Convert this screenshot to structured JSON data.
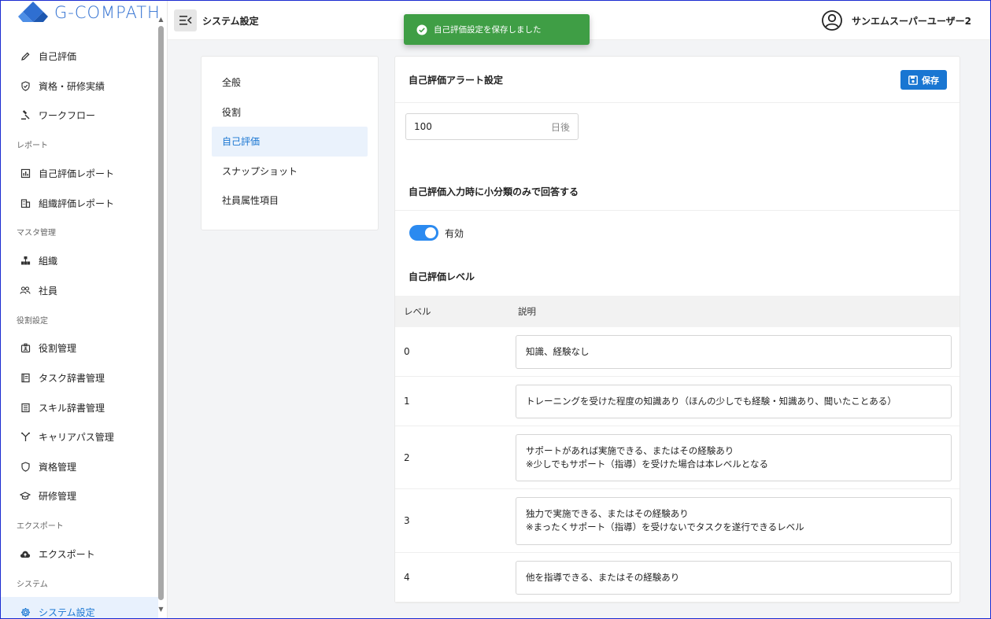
{
  "app": {
    "logo_text": "G-COMPATH",
    "brand_colors": {
      "primary": "#1976d2",
      "logo": "#2f6fd1",
      "toast": "#3f9e45"
    }
  },
  "sidebar": {
    "items": [
      {
        "type": "item",
        "label": "自己評価",
        "icon": "pencil-icon"
      },
      {
        "type": "item",
        "label": "資格・研修実績",
        "icon": "shield-check-icon"
      },
      {
        "type": "item",
        "label": "ワークフロー",
        "icon": "gavel-icon"
      },
      {
        "type": "section",
        "label": "レポート"
      },
      {
        "type": "item",
        "label": "自己評価レポート",
        "icon": "chart-icon"
      },
      {
        "type": "item",
        "label": "組織評価レポート",
        "icon": "building-icon"
      },
      {
        "type": "section",
        "label": "マスタ管理"
      },
      {
        "type": "item",
        "label": "組織",
        "icon": "organization-icon"
      },
      {
        "type": "item",
        "label": "社員",
        "icon": "people-icon"
      },
      {
        "type": "section",
        "label": "役割設定"
      },
      {
        "type": "item",
        "label": "役割管理",
        "icon": "badge-icon"
      },
      {
        "type": "item",
        "label": "タスク辞書管理",
        "icon": "book-icon"
      },
      {
        "type": "item",
        "label": "スキル辞書管理",
        "icon": "list-book-icon"
      },
      {
        "type": "item",
        "label": "キャリアパス管理",
        "icon": "fork-icon"
      },
      {
        "type": "item",
        "label": "資格管理",
        "icon": "shield-icon"
      },
      {
        "type": "item",
        "label": "研修管理",
        "icon": "graduation-cap-icon"
      },
      {
        "type": "section",
        "label": "エクスポート"
      },
      {
        "type": "item",
        "label": "エクスポート",
        "icon": "cloud-upload-icon"
      },
      {
        "type": "section",
        "label": "システム"
      },
      {
        "type": "item",
        "label": "システム設定",
        "icon": "gear-icon",
        "active": true
      }
    ]
  },
  "header": {
    "title": "システム設定",
    "user_name": "サンエムスーパーユーザー2"
  },
  "toast": {
    "message": "自己評価設定を保存しました"
  },
  "settings_nav": {
    "items": [
      {
        "label": "全般"
      },
      {
        "label": "役割"
      },
      {
        "label": "自己評価",
        "active": true
      },
      {
        "label": "スナップショット"
      },
      {
        "label": "社員属性項目"
      }
    ]
  },
  "main": {
    "alert_title": "自己評価アラート設定",
    "save_label": "保存",
    "days_value": "100",
    "days_suffix": "日後",
    "subcategory_title": "自己評価入力時に小分類のみで回答する",
    "toggle_label": "有効",
    "toggle_on": true,
    "levels_title": "自己評価レベル",
    "table": {
      "col_level": "レベル",
      "col_desc": "説明",
      "rows": [
        {
          "level": "0",
          "lines": [
            "知識、経験なし"
          ]
        },
        {
          "level": "1",
          "lines": [
            "トレーニングを受けた程度の知識あり（ほんの少しでも経験・知識あり、聞いたことある）"
          ]
        },
        {
          "level": "2",
          "lines": [
            "サポートがあれば実施できる、またはその経験あり",
            "※少しでもサポート（指導）を受けた場合は本レベルとなる"
          ]
        },
        {
          "level": "3",
          "lines": [
            "独力で実施できる、またはその経験あり",
            "※まったくサポート（指導）を受けないでタスクを遂行できるレベル"
          ]
        },
        {
          "level": "4",
          "lines": [
            "他を指導できる、またはその経験あり"
          ]
        }
      ]
    }
  }
}
